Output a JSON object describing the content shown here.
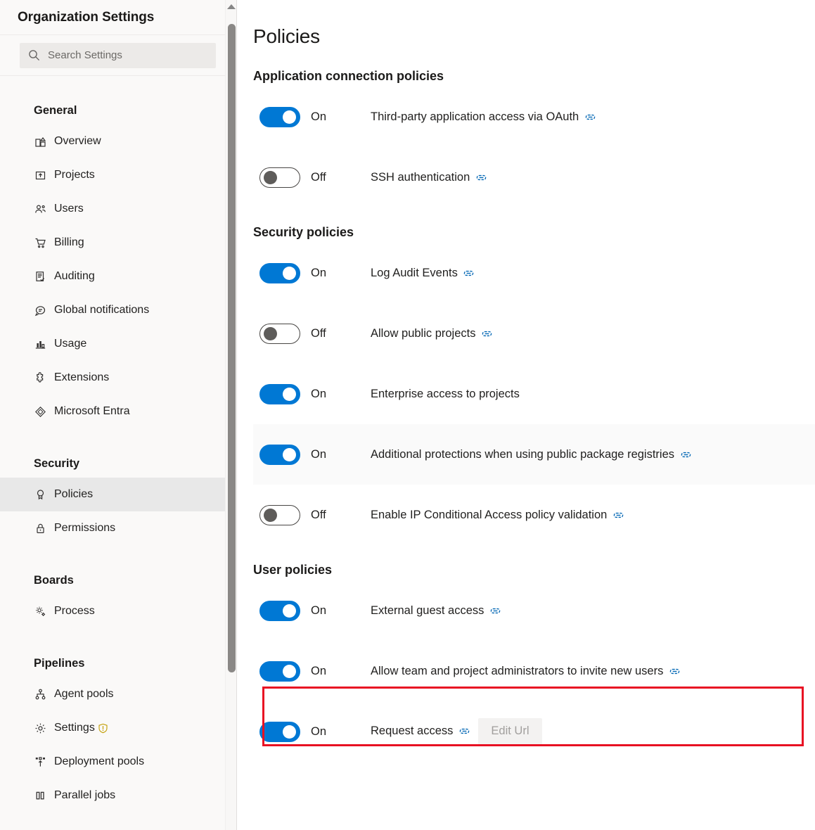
{
  "sidebar": {
    "title": "Organization Settings",
    "search": {
      "placeholder": "Search Settings",
      "icon": "search-icon",
      "value": ""
    },
    "groups": [
      {
        "title": "General",
        "items": [
          {
            "label": "Overview",
            "icon": "overview-icon",
            "selected": false
          },
          {
            "label": "Projects",
            "icon": "projects-icon",
            "selected": false
          },
          {
            "label": "Users",
            "icon": "users-icon",
            "selected": false
          },
          {
            "label": "Billing",
            "icon": "billing-cart-icon",
            "selected": false
          },
          {
            "label": "Auditing",
            "icon": "auditing-icon",
            "selected": false
          },
          {
            "label": "Global notifications",
            "icon": "notification-icon",
            "selected": false
          },
          {
            "label": "Usage",
            "icon": "usage-chart-icon",
            "selected": false
          },
          {
            "label": "Extensions",
            "icon": "extensions-icon",
            "selected": false
          },
          {
            "label": "Microsoft Entra",
            "icon": "entra-icon",
            "selected": false
          }
        ]
      },
      {
        "title": "Security",
        "items": [
          {
            "label": "Policies",
            "icon": "policies-icon",
            "selected": true
          },
          {
            "label": "Permissions",
            "icon": "lock-icon",
            "selected": false
          }
        ]
      },
      {
        "title": "Boards",
        "items": [
          {
            "label": "Process",
            "icon": "process-gear-icon",
            "selected": false
          }
        ]
      },
      {
        "title": "Pipelines",
        "items": [
          {
            "label": "Agent pools",
            "icon": "agent-pools-icon",
            "selected": false
          },
          {
            "label": "Settings",
            "icon": "settings-gear-icon",
            "selected": false,
            "badge": "warning-shield-icon"
          },
          {
            "label": "Deployment pools",
            "icon": "deployment-pools-icon",
            "selected": false
          },
          {
            "label": "Parallel jobs",
            "icon": "parallel-jobs-icon",
            "selected": false
          }
        ]
      }
    ]
  },
  "main": {
    "page_title": "Policies",
    "sections": [
      {
        "title": "Application connection policies",
        "policies": [
          {
            "state": "On",
            "on": true,
            "label": "Third-party application access via OAuth",
            "info": true,
            "hovered": false
          },
          {
            "state": "Off",
            "on": false,
            "label": "SSH authentication",
            "info": true,
            "hovered": false
          }
        ]
      },
      {
        "title": "Security policies",
        "policies": [
          {
            "state": "On",
            "on": true,
            "label": "Log Audit Events",
            "info": true,
            "hovered": false
          },
          {
            "state": "Off",
            "on": false,
            "label": "Allow public projects",
            "info": true,
            "hovered": false
          },
          {
            "state": "On",
            "on": true,
            "label": "Enterprise access to projects",
            "info": false,
            "hovered": false
          },
          {
            "state": "On",
            "on": true,
            "label": "Additional protections when using public package registries",
            "info": true,
            "hovered": true
          },
          {
            "state": "Off",
            "on": false,
            "label": "Enable IP Conditional Access policy validation",
            "info": true,
            "hovered": false
          }
        ]
      },
      {
        "title": "User policies",
        "policies": [
          {
            "state": "On",
            "on": true,
            "label": "External guest access",
            "info": true,
            "hovered": false
          },
          {
            "state": "On",
            "on": true,
            "label": "Allow team and project administrators to invite new users",
            "info": true,
            "hovered": false,
            "highlighted": true
          },
          {
            "state": "On",
            "on": true,
            "label": "Request access",
            "info": true,
            "hovered": false,
            "button": "Edit Url"
          }
        ]
      }
    ]
  },
  "colors": {
    "accent": "#0078d4",
    "annotation": "#e81123",
    "sidebar_bg": "#faf9f8",
    "selected_bg": "#e8e8e8",
    "warning": "#c19c00"
  },
  "scrollbar": {
    "arrow_up": "scroll-up-arrow-icon"
  }
}
